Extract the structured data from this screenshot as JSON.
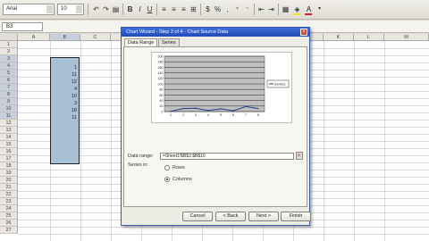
{
  "toolbar": {
    "font_value": "Arial",
    "size_value": "10",
    "bold": "B",
    "italic": "I",
    "underline": "U",
    "percent_label": "%",
    "comma_label": ",",
    "font_color": "A",
    "fill_color_hex": "#f5e33a",
    "font_color_hex": "#d42020"
  },
  "formula_bar": {
    "name_box": "B3"
  },
  "sheet": {
    "columns": [
      "A",
      "B",
      "C",
      "D",
      "E",
      "F",
      "G",
      "H",
      "I",
      "J",
      "K",
      "L",
      "M"
    ],
    "selected_column": "B",
    "row_numbers": [
      "1",
      "2",
      "3",
      "4",
      "5",
      "6",
      "7",
      "8",
      "9",
      "10",
      "11",
      "12",
      "13",
      "14",
      "15",
      "16",
      "17",
      "18",
      "19",
      "20",
      "21",
      "22",
      "23",
      "24",
      "25",
      "26",
      "27"
    ],
    "selected_rows": [
      "3",
      "4",
      "5",
      "6",
      "7",
      "8",
      "9",
      "10",
      "11"
    ],
    "cell_values": [
      "1",
      "11",
      "12",
      "4",
      "10",
      "3",
      "18",
      "11"
    ]
  },
  "dialog": {
    "title": "Chart Wizard - Step 2 of 4 - Chart Source Data",
    "close_label": "×",
    "tabs": [
      "Data Range",
      "Series"
    ],
    "active_tab": "Data Range",
    "data_range_label": "Data range:",
    "data_range_value": "=Sheet1!$B$3:$B$10",
    "series_in_label": "Series in:",
    "rows_label": "Rows",
    "columns_label": "Columns",
    "legend_label": "Series1",
    "buttons": {
      "cancel": "Cancel",
      "back": "< Back",
      "next": "Next >",
      "finish": "Finish"
    }
  },
  "chart_data": {
    "type": "line",
    "x": [
      1,
      2,
      3,
      4,
      5,
      6,
      7,
      8
    ],
    "series": [
      {
        "name": "Series1",
        "values": [
          1,
          11,
          12,
          4,
          10,
          3,
          18,
          11
        ]
      }
    ],
    "y_ticks": [
      0,
      20,
      40,
      60,
      80,
      100,
      120,
      140,
      160,
      180,
      200
    ],
    "ylim": [
      0,
      200
    ],
    "grid": true,
    "legend": "right",
    "line_color": "#1e3c8c",
    "plot_area_color": "#c0c0c0"
  }
}
